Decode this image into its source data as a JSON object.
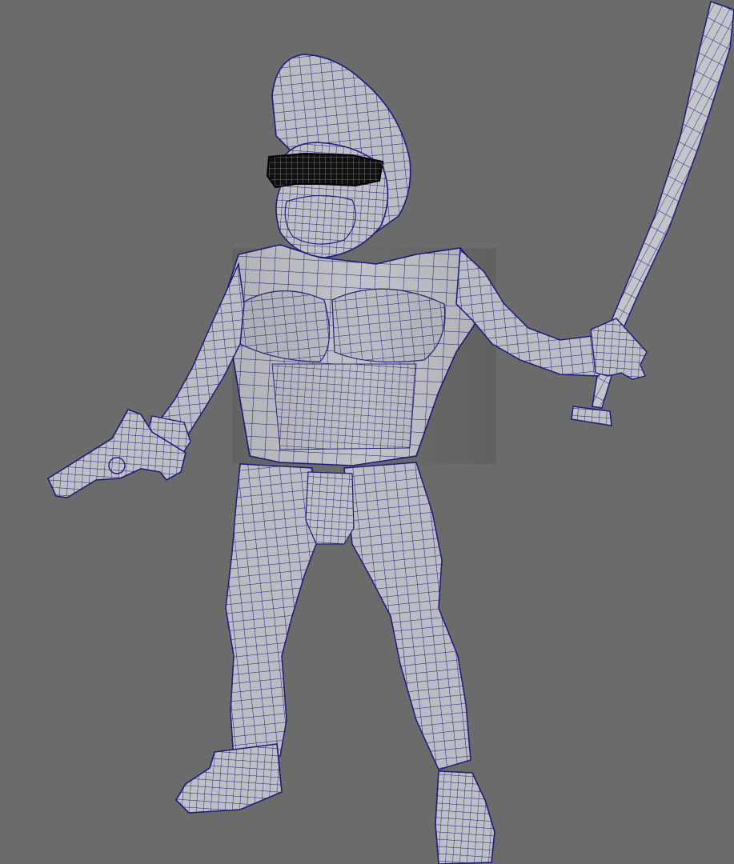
{
  "viewport": {
    "background": "#6b6b6b",
    "display_mode": "wireframe-on-shaded"
  },
  "colors": {
    "mesh_fill": "#bdbdc4",
    "mesh_shadow": "#a5a5ae",
    "wire": "#1c1c7a",
    "glasses_fill": "#0c0c0c",
    "glasses_wire": "#8a8a8a"
  },
  "objects": [
    {
      "name": "character-body",
      "icon": "mesh-icon"
    },
    {
      "name": "sunglasses",
      "icon": "mesh-icon"
    },
    {
      "name": "baseball-bat",
      "icon": "mesh-icon"
    },
    {
      "name": "pistol",
      "icon": "mesh-icon"
    }
  ]
}
